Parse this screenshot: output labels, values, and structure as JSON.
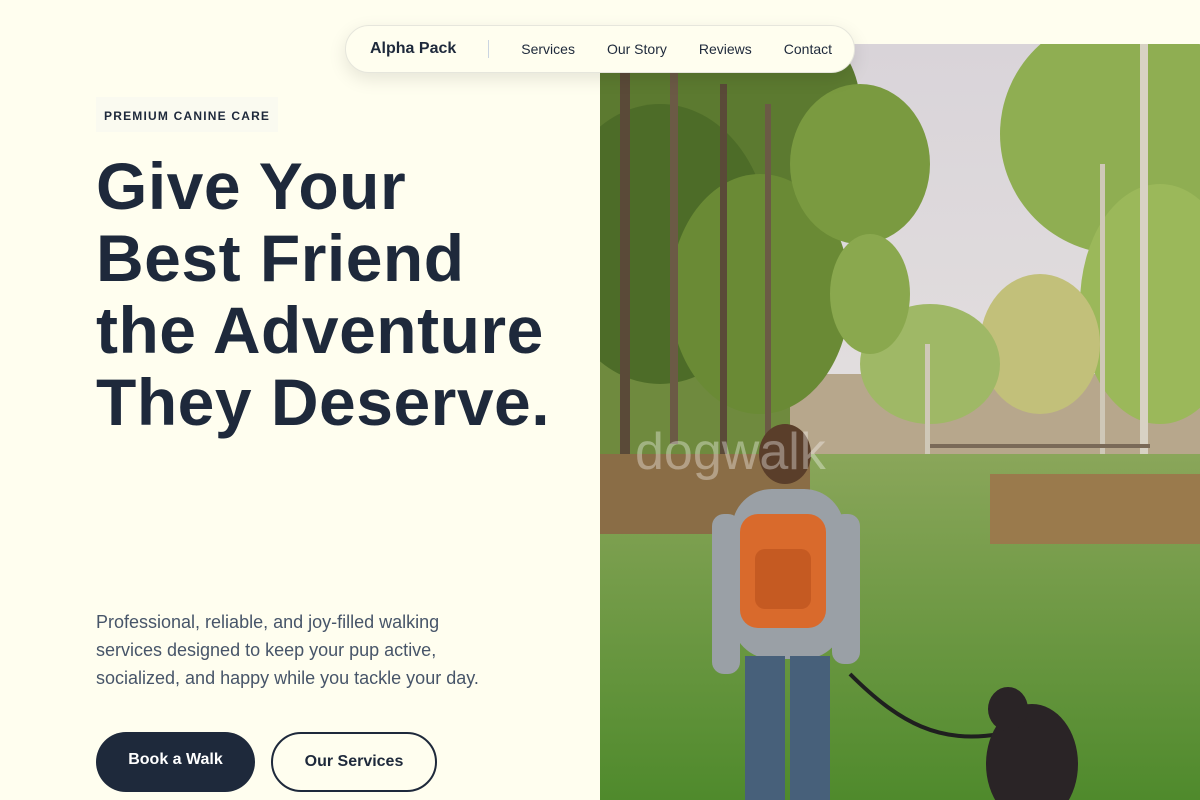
{
  "nav": {
    "brand": "Alpha Pack",
    "links": [
      "Services",
      "Our Story",
      "Reviews",
      "Contact"
    ]
  },
  "hero": {
    "eyebrow": "PREMIUM CANINE CARE",
    "headline": "Give Your Best Friend the Adventure They Deserve.",
    "subtext": "Professional, reliable, and joy-filled walking services designed to keep your pup active, socialized, and happy while you tackle your day.",
    "primary_button": "Book a Walk",
    "secondary_button": "Our Services",
    "photo_watermark": "dogwalk"
  },
  "colors": {
    "background": "#fffeef",
    "text_dark": "#1e293b",
    "text_muted": "#475569",
    "button_primary": "#1e293b"
  },
  "icons": [
    "hero-photo-dog-walker"
  ]
}
